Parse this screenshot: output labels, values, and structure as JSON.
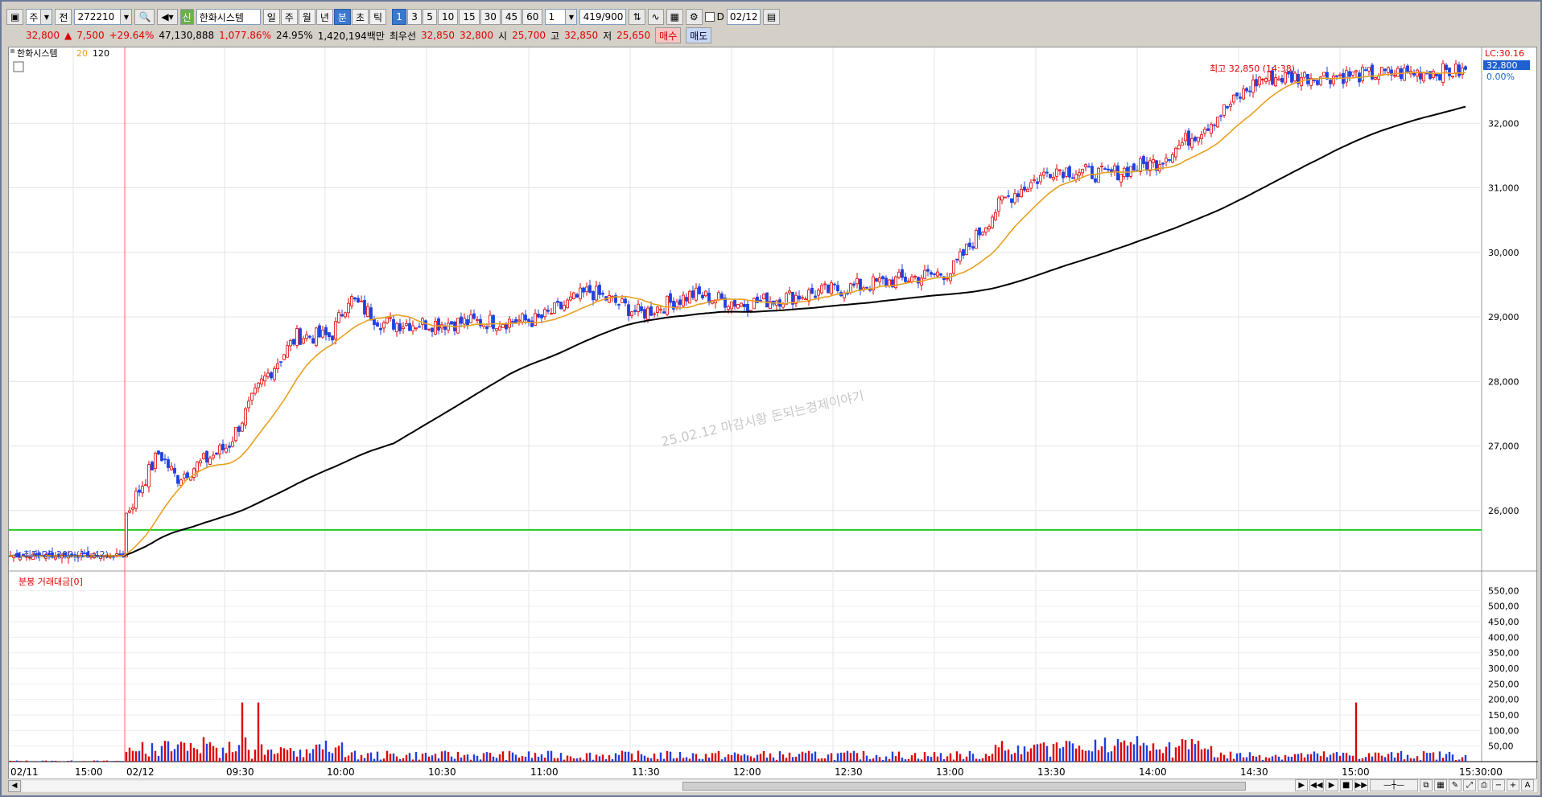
{
  "toolbar": {
    "type_select": "주",
    "jeon_label": "전",
    "code": "272210",
    "stock_name": "한화시스템",
    "sin_badge": "신",
    "periods": [
      "일",
      "주",
      "월",
      "년",
      "분",
      "초",
      "틱"
    ],
    "selected_period": "분",
    "intervals": [
      "1",
      "3",
      "5",
      "10",
      "15",
      "30",
      "45",
      "60"
    ],
    "selected_interval": "1",
    "multiplier": "1",
    "count": "419/900",
    "d_label": "D",
    "date": "02/12"
  },
  "info": {
    "price": "32,800",
    "arrow": "▲",
    "change": "7,500",
    "change_pct": "+29.64%",
    "volume": "47,130,888",
    "vol_pct": "1,077.86%",
    "turnover": "24.95%",
    "amount": "1,420,194백만",
    "best_label": "최우선",
    "best_ask": "32,850",
    "best_bid": "32,800",
    "open_label": "시",
    "open": "25,700",
    "high_label": "고",
    "high": "32,850",
    "low_label": "저",
    "low": "25,650",
    "buy_label": "매수",
    "sell_label": "매도"
  },
  "price_panel": {
    "title": "한화시스템",
    "ma_short": "20",
    "ma_long": "120",
    "lc": "LC:30.16",
    "current_tag": "32,800",
    "pct_tag": "0.00%",
    "high_note": "최고 32,850 (14:38)",
    "low_note": "최저 25,200 (14:42)",
    "watermark": "25.02.12 마감시황 돈되는경제이야기",
    "y_ticks": [
      "32,000",
      "31,000",
      "30,000",
      "29,000",
      "28,000",
      "27,000",
      "26,000"
    ]
  },
  "volume_panel": {
    "title": "분봉 거래대금[0]",
    "y_ticks": [
      "550,00",
      "500,00",
      "450,00",
      "400,00",
      "350,00",
      "300,00",
      "250,00",
      "200,00",
      "150,00",
      "100,00",
      "50,00"
    ]
  },
  "x_axis": {
    "labels": [
      "02/11",
      "15:00",
      "02/12",
      "09:30",
      "10:00",
      "10:30",
      "11:00",
      "11:30",
      "12:00",
      "12:30",
      "13:00",
      "13:30",
      "14:00",
      "14:30",
      "15:00",
      "15:30:00"
    ]
  },
  "colors": {
    "up": "#e00000",
    "down": "#1f3fe0",
    "ma20": "#e8a020",
    "ma120": "#000000",
    "support": "#22cc22"
  },
  "chart_data": {
    "type": "line",
    "ylim": [
      25100,
      33100
    ],
    "price_series": [
      {
        "time": "14:42",
        "price": 25250
      },
      {
        "time": "09:00",
        "price": 25900
      },
      {
        "time": "09:10",
        "price": 26900
      },
      {
        "time": "09:15",
        "price": 26500
      },
      {
        "time": "09:30",
        "price": 27000
      },
      {
        "time": "09:40",
        "price": 28000
      },
      {
        "time": "09:50",
        "price": 28700
      },
      {
        "time": "10:00",
        "price": 28700
      },
      {
        "time": "10:05",
        "price": 29300
      },
      {
        "time": "10:15",
        "price": 28900
      },
      {
        "time": "10:30",
        "price": 28900
      },
      {
        "time": "11:00",
        "price": 28950
      },
      {
        "time": "11:15",
        "price": 29400
      },
      {
        "time": "11:30",
        "price": 29050
      },
      {
        "time": "11:45",
        "price": 29350
      },
      {
        "time": "12:00",
        "price": 29200
      },
      {
        "time": "12:30",
        "price": 29450
      },
      {
        "time": "13:00",
        "price": 29700
      },
      {
        "time": "13:15",
        "price": 30800
      },
      {
        "time": "13:30",
        "price": 31300
      },
      {
        "time": "13:45",
        "price": 31200
      },
      {
        "time": "14:00",
        "price": 31400
      },
      {
        "time": "14:15",
        "price": 32000
      },
      {
        "time": "14:30",
        "price": 32700
      },
      {
        "time": "15:00",
        "price": 32750
      },
      {
        "time": "15:20",
        "price": 32800
      }
    ],
    "support_level": 25700
  }
}
